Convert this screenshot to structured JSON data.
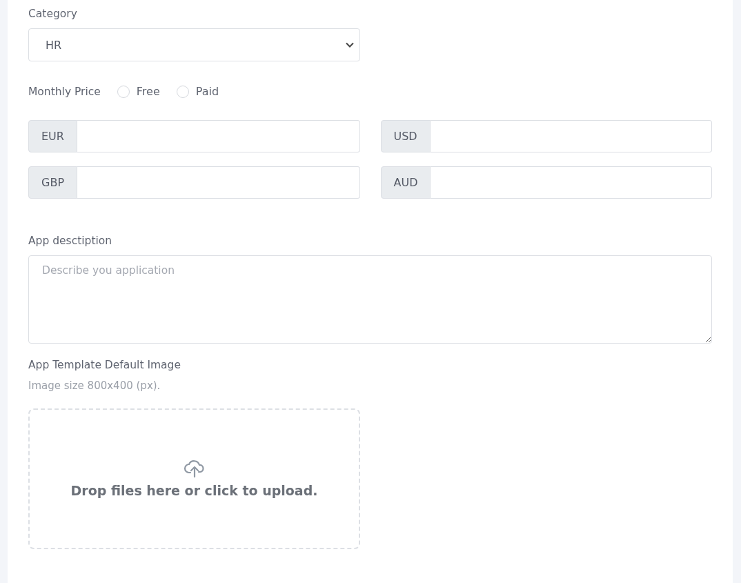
{
  "category": {
    "label": "Category",
    "value": "HR"
  },
  "monthly_price": {
    "label": "Monthly Price",
    "options": [
      {
        "label": "Free",
        "selected": false
      },
      {
        "label": "Paid",
        "selected": false
      }
    ]
  },
  "currencies": [
    {
      "code": "EUR"
    },
    {
      "code": "USD"
    },
    {
      "code": "GBP"
    },
    {
      "code": "AUD"
    }
  ],
  "description": {
    "label": "App desctiption",
    "placeholder": "Describe you application"
  },
  "image": {
    "label": "App Template Default Image",
    "hint": "Image size 800x400 (px).",
    "dropzone_text": "Drop files here or click to upload."
  }
}
